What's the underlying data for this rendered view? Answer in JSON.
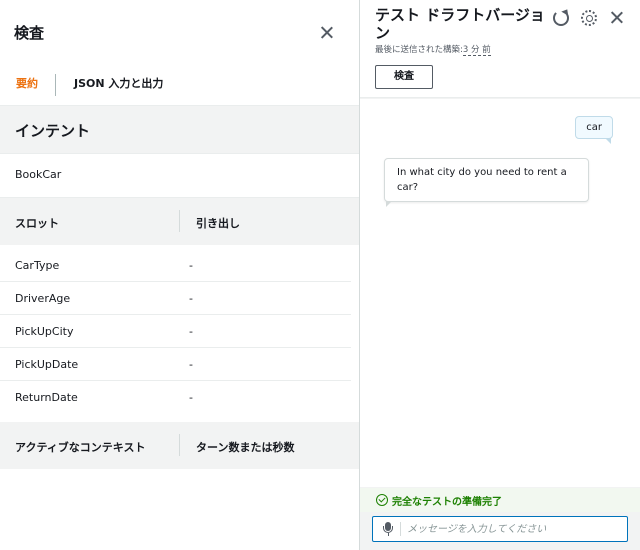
{
  "inspect": {
    "title": "検査",
    "tabs": [
      {
        "label": "要約",
        "active": true
      },
      {
        "label": "JSON 入力と出力",
        "active": false
      }
    ],
    "intent": {
      "heading": "インテント",
      "value": "BookCar"
    },
    "slots": {
      "headers": [
        "スロット",
        "引き出し"
      ],
      "rows": [
        {
          "name": "CarType",
          "value": "-"
        },
        {
          "name": "DriverAge",
          "value": "-"
        },
        {
          "name": "PickUpCity",
          "value": "-"
        },
        {
          "name": "PickUpDate",
          "value": "-"
        },
        {
          "name": "ReturnDate",
          "value": "-"
        }
      ]
    },
    "contexts": {
      "headers": [
        "アクティブなコンテキスト",
        "ターン数または秒数"
      ]
    }
  },
  "test": {
    "title": "テスト ドラフトバージョン",
    "subtitle_prefix": "最後に送信された構築:",
    "subtitle_relative": "3 分 前",
    "inspect_button": "検査",
    "messages": [
      {
        "from": "user",
        "text": "car"
      },
      {
        "from": "bot",
        "text": "In what city do you need to rent a car?"
      }
    ],
    "status": "完全なテストの準備完了",
    "input": {
      "placeholder": "メッセージを入力してください",
      "value": ""
    }
  },
  "colors": {
    "accent_tab": "#ec7211",
    "link_blue": "#0073bb",
    "status_green": "#1d8102",
    "user_bubble": "#f1faff"
  },
  "icons": [
    "close-icon",
    "refresh-icon",
    "settings-gear-icon",
    "check-circle-icon",
    "microphone-icon"
  ]
}
